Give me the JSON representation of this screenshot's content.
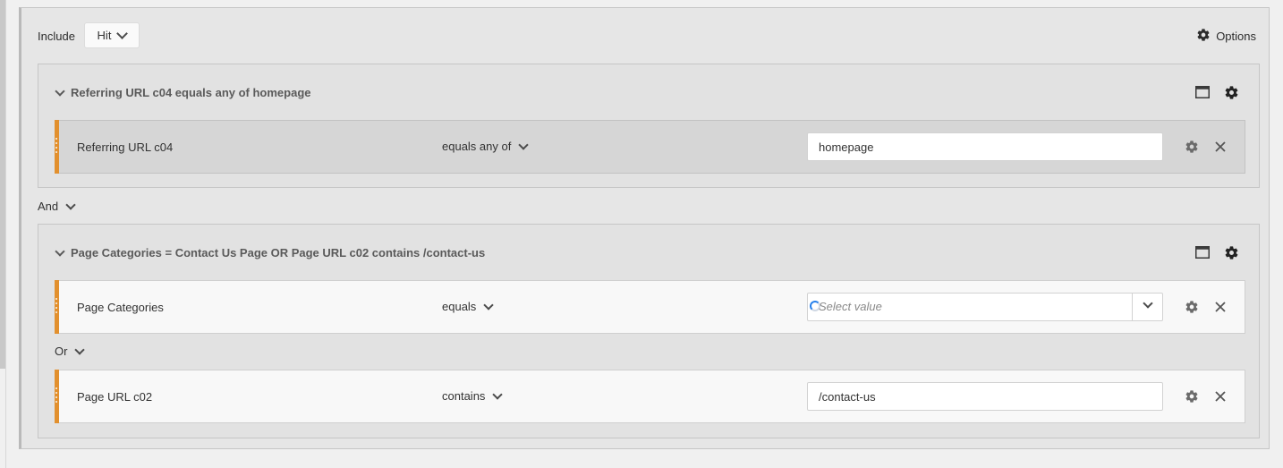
{
  "header": {
    "include_label": "Include",
    "include_value": "Hit",
    "options_label": "Options"
  },
  "containers": [
    {
      "title": "Referring URL c04 equals any of homepage",
      "rules": [
        {
          "dimension": "Referring URL c04",
          "operator": "equals any of",
          "value": "homepage"
        }
      ]
    },
    {
      "title": "Page Categories = Contact Us Page OR Page URL c02 contains /contact-us",
      "rules": [
        {
          "dimension": "Page Categories",
          "operator": "equals",
          "placeholder": "Select value"
        },
        {
          "dimension": "Page URL c02",
          "operator": "contains",
          "value": "/contact-us"
        }
      ],
      "inner_logic": "Or"
    }
  ],
  "outer_logic": "And"
}
